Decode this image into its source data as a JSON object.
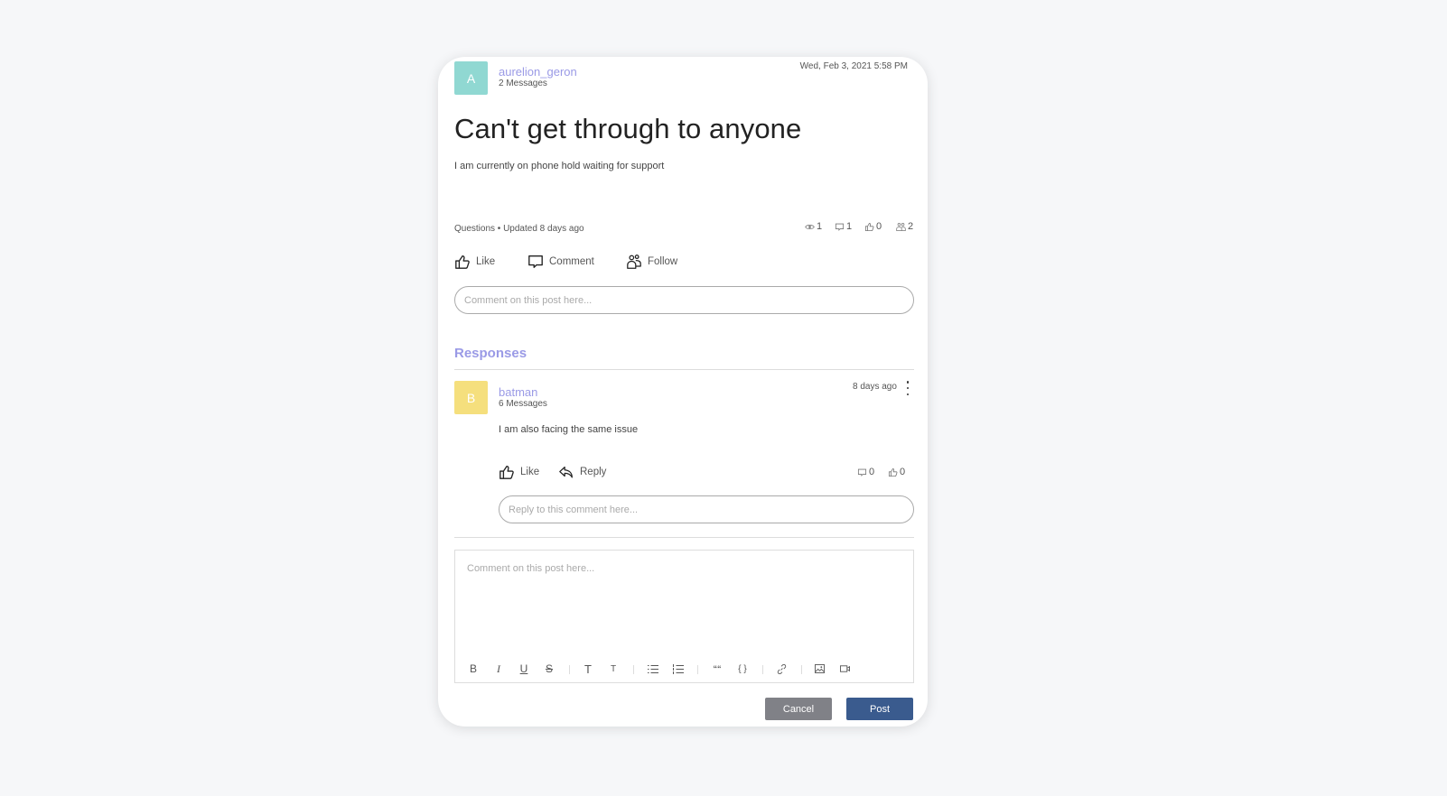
{
  "post": {
    "author": {
      "initial": "A",
      "name": "aurelion_geron",
      "messages": "2 Messages",
      "avatar_color": "#90d8d2"
    },
    "timestamp": "Wed, Feb 3, 2021 5:58 PM",
    "title": "Can't get through to anyone",
    "body": "I am currently on phone hold waiting for support",
    "meta": "Questions • Updated 8 days ago",
    "stats": {
      "views": "1",
      "comments": "1",
      "likes": "0",
      "followers": "2"
    },
    "actions": {
      "like": "Like",
      "comment": "Comment",
      "follow": "Follow"
    },
    "comment_placeholder": "Comment on this post here..."
  },
  "responses": {
    "title": "Responses",
    "items": [
      {
        "author": {
          "initial": "B",
          "name": "batman",
          "messages": "6 Messages",
          "avatar_color": "#f5df7d"
        },
        "time": "8 days ago",
        "body": "I am also facing the same issue",
        "actions": {
          "like": "Like",
          "reply": "Reply"
        },
        "stats": {
          "comments": "0",
          "likes": "0"
        },
        "reply_placeholder": "Reply to this comment here..."
      }
    ]
  },
  "editor": {
    "placeholder": "Comment on this post here...",
    "toolbar": [
      "bold",
      "italic",
      "underline",
      "strikethrough",
      "heading-large",
      "heading-small",
      "bullet-list",
      "numbered-list",
      "quote",
      "code",
      "link",
      "image",
      "video"
    ]
  },
  "buttons": {
    "cancel": "Cancel",
    "post": "Post"
  },
  "colors": {
    "accent": "#9a9ae6",
    "primary_button": "#3a5b8e",
    "cancel_button": "#808187"
  }
}
